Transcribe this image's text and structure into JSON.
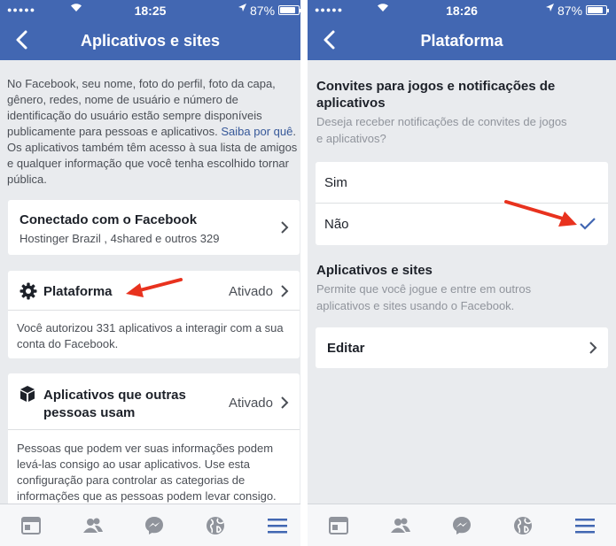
{
  "status_left": {
    "time": "18:25",
    "battery": "87%"
  },
  "status_right": {
    "time": "18:26",
    "battery": "87%"
  },
  "left": {
    "title": "Aplicativos e sites",
    "intro_text": "No Facebook, seu nome, foto do perfil, foto da capa, gênero, redes, nome de usuário e número de identificação do usuário estão sempre disponíveis publicamente para pessoas e aplicativos.",
    "intro_link": "Saiba por quê",
    "intro_tail": ". Os aplicativos também têm acesso à sua lista de amigos e qualquer informação que você tenha escolhido tornar pública.",
    "connected": {
      "title": "Conectado com o Facebook",
      "subtitle": "Hostinger Brazil , 4shared e outros 329"
    },
    "platform": {
      "title": "Plataforma",
      "value": "Ativado",
      "desc": "Você autorizou 331 aplicativos a interagir com a sua conta do Facebook."
    },
    "others": {
      "title_line1": "Aplicativos que outras",
      "title_line2": "pessoas usam",
      "value": "Ativado",
      "desc": "Pessoas que podem ver suas informações podem levá-las consigo ao usar aplicativos. Use esta configuração para controlar as categorias de informações que as pessoas podem levar consigo."
    }
  },
  "right": {
    "title": "Plataforma",
    "invites": {
      "title_line1": "Convites para jogos e notificações de",
      "title_line2": "aplicativos",
      "sub_line1": "Deseja receber notificações de convites de jogos",
      "sub_line2": "e aplicativos?"
    },
    "options": [
      {
        "label": "Sim",
        "selected": false
      },
      {
        "label": "Não",
        "selected": true
      }
    ],
    "apps": {
      "title": "Aplicativos e sites",
      "sub_line1": "Permite que você jogue e entre em outros",
      "sub_line2": "aplicativos e sites usando o Facebook."
    },
    "edit_label": "Editar"
  },
  "colors": {
    "brand": "#4267b2",
    "background": "#e9ebee",
    "active_tab": "#4267b2",
    "arrow": "#e8321e",
    "check": "#4267b2"
  },
  "tabs": [
    "news-feed-icon",
    "friends-icon",
    "messenger-icon",
    "globe-icon",
    "menu-icon"
  ]
}
